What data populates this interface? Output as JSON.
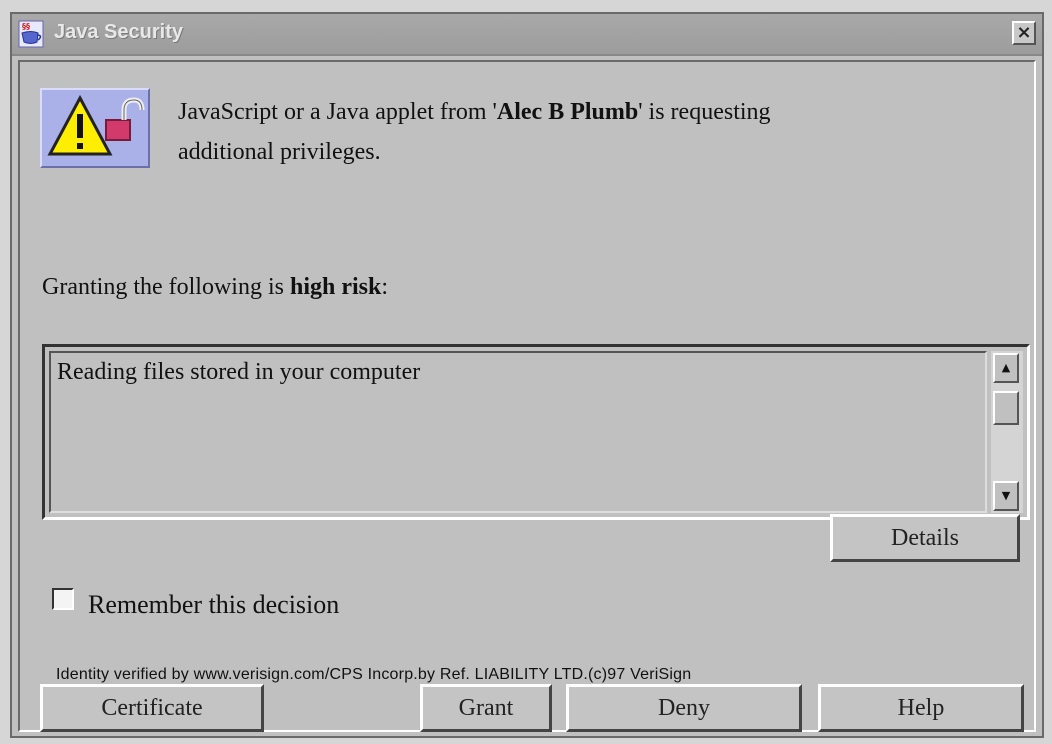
{
  "window": {
    "title": "Java Security",
    "close_label": "×"
  },
  "request": {
    "prefix": "JavaScript or a Java applet from '",
    "requester": "Alec B Plumb",
    "suffix": "' is requesting",
    "line2": "additional privileges."
  },
  "risk": {
    "prefix": "Granting the following is ",
    "level": "high risk",
    "suffix": ":"
  },
  "privileges_list": {
    "items": [
      "Reading files stored in your computer"
    ],
    "scroll_up": "▲",
    "scroll_down": "▼"
  },
  "buttons": {
    "details": "Details",
    "certificate": "Certificate",
    "grant": "Grant",
    "deny": "Deny",
    "help": "Help"
  },
  "remember": {
    "label": "Remember this decision",
    "checked": false
  },
  "identity_text": "Identity verified by www.verisign.com/CPS Incorp.by Ref. LIABILITY LTD.(c)97 VeriSign",
  "icons": {
    "title_icon": "java-cup-icon",
    "warning_icon": "warning-unlock-icon"
  }
}
